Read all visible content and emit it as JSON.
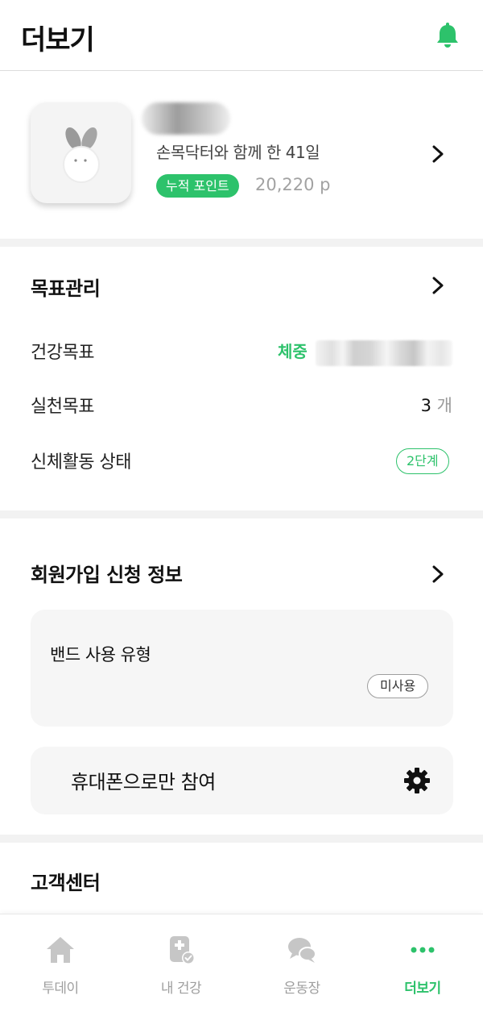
{
  "header": {
    "title": "더보기",
    "bell_icon": "bell-icon",
    "accent": "#2dc26b"
  },
  "profile": {
    "days_text": "손목닥터와 함께 한 41일",
    "points_badge": "누적 포인트",
    "points_value": "20,220 p"
  },
  "goals": {
    "title": "목표관리",
    "health_goal_label": "건강목표",
    "weight_label": "체중",
    "practice_goal_label": "실천목표",
    "practice_count": "3",
    "practice_unit": "개",
    "activity_label": "신체활동 상태",
    "activity_level": "2단계"
  },
  "signup": {
    "title": "회원가입 신청 정보",
    "band_title": "밴드 사용 유형",
    "band_value": "미사용",
    "phone_only": "휴대폰으로만 참여"
  },
  "support": {
    "title": "고객센터"
  },
  "tabs": [
    {
      "label": "투데이",
      "icon": "home-icon",
      "active": false
    },
    {
      "label": "내 건강",
      "icon": "health-record-icon",
      "active": false
    },
    {
      "label": "운동장",
      "icon": "chat-bubbles-icon",
      "active": false
    },
    {
      "label": "더보기",
      "icon": "more-dots-icon",
      "active": true
    }
  ]
}
